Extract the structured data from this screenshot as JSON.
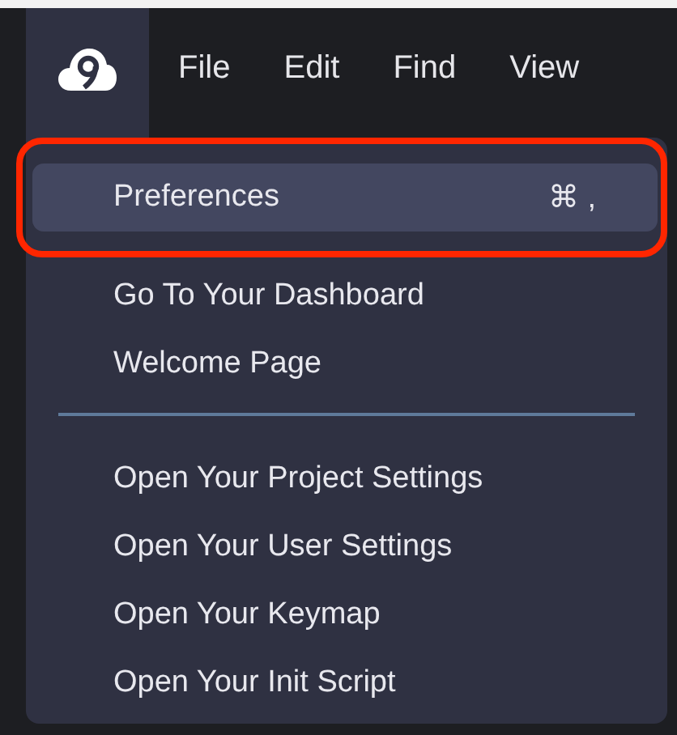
{
  "menubar": {
    "app_menu_open": true,
    "items": [
      {
        "label": "File"
      },
      {
        "label": "Edit"
      },
      {
        "label": "Find"
      },
      {
        "label": "View"
      }
    ]
  },
  "menu": {
    "items": [
      {
        "kind": "item",
        "label": "Preferences",
        "shortcut": "⌘ ,",
        "selected": true,
        "annotated": true
      },
      {
        "kind": "item",
        "label": "Go To Your Dashboard",
        "selected": false,
        "annotated": false
      },
      {
        "kind": "item",
        "label": "Welcome Page",
        "selected": false,
        "annotated": false
      },
      {
        "kind": "separator"
      },
      {
        "kind": "item",
        "label": "Open Your Project Settings",
        "selected": false,
        "annotated": false
      },
      {
        "kind": "item",
        "label": "Open Your User Settings",
        "selected": false,
        "annotated": false
      },
      {
        "kind": "item",
        "label": "Open Your Keymap",
        "selected": false,
        "annotated": false
      },
      {
        "kind": "item",
        "label": "Open Your Init Script",
        "selected": false,
        "annotated": false
      }
    ]
  }
}
